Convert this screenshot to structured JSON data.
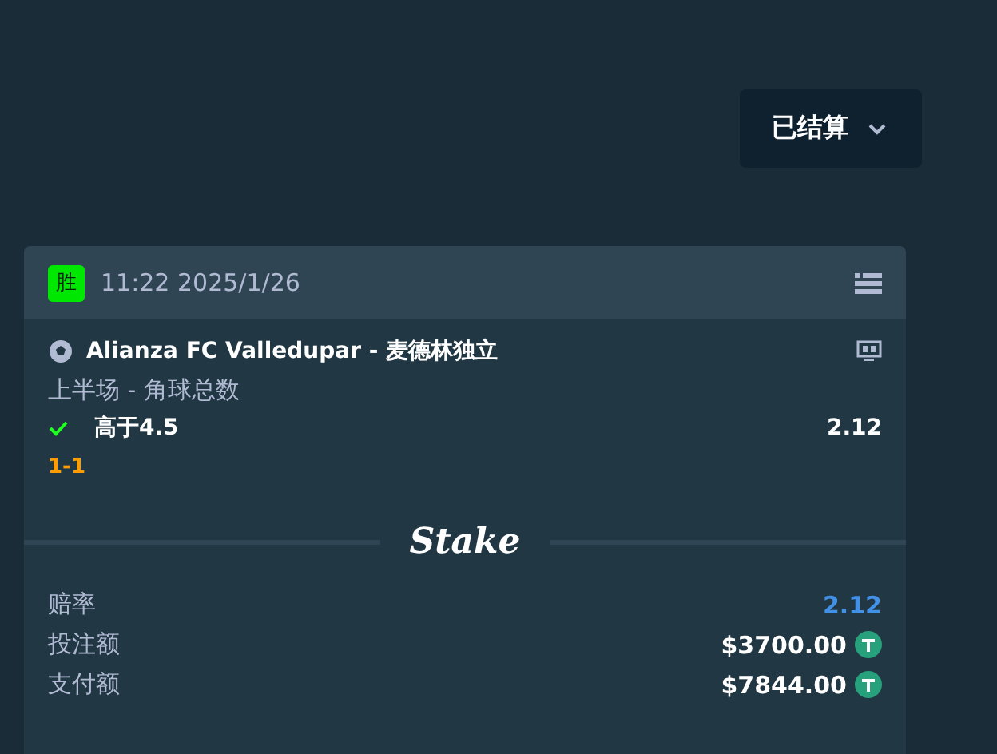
{
  "filter_dropdown": {
    "label": "已结算"
  },
  "bet_card": {
    "status": {
      "label": "胜",
      "color": "#00e701"
    },
    "time": "11:22 2025/1/26",
    "event": {
      "title": "Alianza FC Valledupar - 麦德林独立",
      "market": "上半场 - 角球总数",
      "outcome": {
        "label": "高于4.5",
        "won": true,
        "odds": "2.12"
      },
      "score": "1-1"
    },
    "logo": "Stake",
    "summary": [
      {
        "kind": "odds",
        "label": "赔率",
        "value": "2.12"
      },
      {
        "kind": "amount",
        "label": "投注额",
        "value": "$3700.00"
      },
      {
        "kind": "amount",
        "label": "支付额",
        "value": "$7844.00"
      }
    ]
  }
}
